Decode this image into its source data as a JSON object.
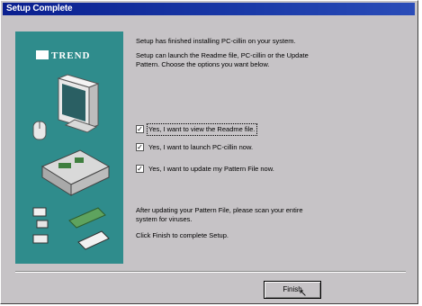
{
  "window": {
    "title": "Setup Complete"
  },
  "side_panel": {
    "logo_text": "TREND"
  },
  "content": {
    "p1": "Setup has finished installing PC-cillin on your system.",
    "p2_line1": "Setup can launch the Readme file, PC-cillin or the Update",
    "p2_line2": "Pattern. Choose the options you want below.",
    "options": [
      {
        "label": "Yes, I want to view the Readme file.",
        "checked": true
      },
      {
        "label": "Yes, I want to launch PC-cillin now.",
        "checked": true
      },
      {
        "label": "Yes, I want to update my Pattern File now.",
        "checked": true
      }
    ],
    "p3_line1": "After updating your Pattern File, please scan your entire",
    "p3_line2": "system for viruses.",
    "p4": "Click Finish to complete Setup."
  },
  "buttons": {
    "finish": "Finish"
  },
  "colors": {
    "title_bar": "#0a1f8f",
    "side_panel": "#2f8c8c",
    "dialog_bg": "#c6c3c6"
  }
}
